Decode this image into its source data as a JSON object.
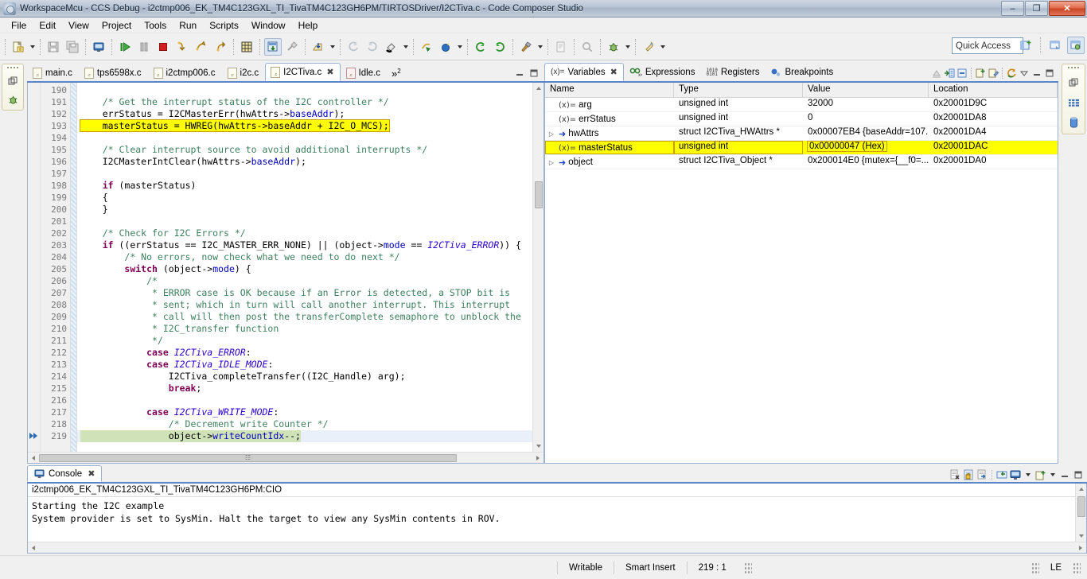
{
  "window": {
    "title": "WorkspaceMcu - CCS Debug - i2ctmp006_EK_TM4C123GXL_TI_TivaTM4C123GH6PM/TIRTOSDriver/I2CTiva.c - Code Composer Studio",
    "minimize_label": "–",
    "restore_label": "❐",
    "close_label": "✕"
  },
  "menu": {
    "items": [
      {
        "label": "File"
      },
      {
        "label": "Edit"
      },
      {
        "label": "View"
      },
      {
        "label": "Project"
      },
      {
        "label": "Tools"
      },
      {
        "label": "Run"
      },
      {
        "label": "Scripts"
      },
      {
        "label": "Window"
      },
      {
        "label": "Help"
      }
    ]
  },
  "toolbar": {
    "quick_access_placeholder": "Quick Access",
    "quick_access_value": "",
    "buttons": [
      {
        "name": "new-icon"
      },
      {
        "name": "save-icon"
      },
      {
        "name": "save-all-icon"
      },
      {
        "name": "open-console-icon"
      },
      {
        "name": "resume-icon"
      },
      {
        "name": "suspend-icon"
      },
      {
        "name": "terminate-icon"
      },
      {
        "name": "step-into-icon"
      },
      {
        "name": "step-over-icon"
      },
      {
        "name": "step-return-icon"
      },
      {
        "name": "grid-icon"
      },
      {
        "name": "load-program-icon"
      },
      {
        "name": "connect-target-icon"
      },
      {
        "name": "disconnect-target-icon"
      },
      {
        "name": "restart-icon"
      },
      {
        "name": "reset-icon"
      },
      {
        "name": "refresh-icon"
      },
      {
        "name": "build-icon"
      },
      {
        "name": "search-icon"
      },
      {
        "name": "debug-icon"
      },
      {
        "name": "run-icon"
      }
    ],
    "perspective": [
      {
        "name": "open-perspective-icon"
      },
      {
        "name": "perspective-ccs-edit-icon"
      },
      {
        "name": "perspective-ccs-debug-icon"
      }
    ]
  },
  "editor": {
    "tabs": [
      {
        "label": "main.c",
        "active": false,
        "dirty": false
      },
      {
        "label": "tps6598x.c",
        "active": false,
        "dirty": false
      },
      {
        "label": "i2ctmp006.c",
        "active": false,
        "dirty": false
      },
      {
        "label": "i2c.c",
        "active": false,
        "dirty": false
      },
      {
        "label": "I2CTiva.c",
        "active": true,
        "dirty": false
      },
      {
        "label": "Idle.c",
        "active": false,
        "dirty": false
      }
    ],
    "overflow_label": "»",
    "overflow_count": "2",
    "minimize_label": "─",
    "maximize_label": "❑",
    "first_line": 190,
    "lines": [
      {
        "n": 190,
        "tokens": []
      },
      {
        "n": 191,
        "tokens": [
          {
            "t": "    ",
            "c": ""
          },
          {
            "t": "/* Get the interrupt status of the I2C controller */",
            "c": "cmt"
          }
        ]
      },
      {
        "n": 192,
        "tokens": [
          {
            "t": "    errStatus = I2CMasterErr(hwAttrs->",
            "c": ""
          },
          {
            "t": "baseAddr",
            "c": "fld"
          },
          {
            "t": ");",
            "c": ""
          }
        ]
      },
      {
        "n": 193,
        "mark": true,
        "tokens": [
          {
            "t": "    masterStatus = HWREG(hwAttrs->baseAddr + I2C_O_MCS);",
            "c": ""
          }
        ]
      },
      {
        "n": 194,
        "tokens": []
      },
      {
        "n": 195,
        "tokens": [
          {
            "t": "    ",
            "c": ""
          },
          {
            "t": "/* Clear interrupt source to avoid additional interrupts */",
            "c": "cmt"
          }
        ]
      },
      {
        "n": 196,
        "tokens": [
          {
            "t": "    I2CMasterIntClear(hwAttrs->",
            "c": ""
          },
          {
            "t": "baseAddr",
            "c": "fld"
          },
          {
            "t": ");",
            "c": ""
          }
        ]
      },
      {
        "n": 197,
        "tokens": []
      },
      {
        "n": 198,
        "tokens": [
          {
            "t": "    ",
            "c": ""
          },
          {
            "t": "if",
            "c": "kw"
          },
          {
            "t": " (masterStatus)",
            "c": ""
          }
        ]
      },
      {
        "n": 199,
        "tokens": [
          {
            "t": "    {",
            "c": ""
          }
        ]
      },
      {
        "n": 200,
        "tokens": [
          {
            "t": "    }",
            "c": ""
          }
        ]
      },
      {
        "n": 201,
        "tokens": []
      },
      {
        "n": 202,
        "tokens": [
          {
            "t": "    ",
            "c": ""
          },
          {
            "t": "/* Check for I2C Errors */",
            "c": "cmt"
          }
        ]
      },
      {
        "n": 203,
        "tokens": [
          {
            "t": "    ",
            "c": ""
          },
          {
            "t": "if",
            "c": "kw"
          },
          {
            "t": " ((errStatus == I2C_MASTER_ERR_NONE) || (object->",
            "c": ""
          },
          {
            "t": "mode",
            "c": "fld"
          },
          {
            "t": " == ",
            "c": ""
          },
          {
            "t": "I2CTiva_ERROR",
            "c": "typ"
          },
          {
            "t": ")) {",
            "c": ""
          }
        ]
      },
      {
        "n": 204,
        "tokens": [
          {
            "t": "        ",
            "c": ""
          },
          {
            "t": "/* No errors, now check what we need to do next */",
            "c": "cmt"
          }
        ]
      },
      {
        "n": 205,
        "tokens": [
          {
            "t": "        ",
            "c": ""
          },
          {
            "t": "switch",
            "c": "kw"
          },
          {
            "t": " (object->",
            "c": ""
          },
          {
            "t": "mode",
            "c": "fld"
          },
          {
            "t": ") {",
            "c": ""
          }
        ]
      },
      {
        "n": 206,
        "tokens": [
          {
            "t": "            ",
            "c": ""
          },
          {
            "t": "/*",
            "c": "cmt"
          }
        ]
      },
      {
        "n": 207,
        "tokens": [
          {
            "t": "             ",
            "c": ""
          },
          {
            "t": "* ERROR case is OK because if an Error is detected, a STOP bit is",
            "c": "cmt"
          }
        ]
      },
      {
        "n": 208,
        "tokens": [
          {
            "t": "             ",
            "c": ""
          },
          {
            "t": "* sent; which in turn will call another interrupt. This interrupt",
            "c": "cmt"
          }
        ]
      },
      {
        "n": 209,
        "tokens": [
          {
            "t": "             ",
            "c": ""
          },
          {
            "t": "* call will then post the transferComplete semaphore to unblock the",
            "c": "cmt"
          }
        ]
      },
      {
        "n": 210,
        "tokens": [
          {
            "t": "             ",
            "c": ""
          },
          {
            "t": "* I2C_transfer function",
            "c": "cmt"
          }
        ]
      },
      {
        "n": 211,
        "tokens": [
          {
            "t": "             ",
            "c": ""
          },
          {
            "t": "*/",
            "c": "cmt"
          }
        ]
      },
      {
        "n": 212,
        "tokens": [
          {
            "t": "            ",
            "c": ""
          },
          {
            "t": "case",
            "c": "kw"
          },
          {
            "t": " ",
            "c": ""
          },
          {
            "t": "I2CTiva_ERROR",
            "c": "typ"
          },
          {
            "t": ":",
            "c": ""
          }
        ]
      },
      {
        "n": 213,
        "tokens": [
          {
            "t": "            ",
            "c": ""
          },
          {
            "t": "case",
            "c": "kw"
          },
          {
            "t": " ",
            "c": ""
          },
          {
            "t": "I2CTiva_IDLE_MODE",
            "c": "typ"
          },
          {
            "t": ":",
            "c": ""
          }
        ]
      },
      {
        "n": 214,
        "tokens": [
          {
            "t": "                I2CTiva_completeTransfer((I2C_Handle) arg);",
            "c": ""
          }
        ]
      },
      {
        "n": 215,
        "tokens": [
          {
            "t": "                ",
            "c": ""
          },
          {
            "t": "break",
            "c": "kw"
          },
          {
            "t": ";",
            "c": ""
          }
        ]
      },
      {
        "n": 216,
        "tokens": []
      },
      {
        "n": 217,
        "tokens": [
          {
            "t": "            ",
            "c": ""
          },
          {
            "t": "case",
            "c": "kw"
          },
          {
            "t": " ",
            "c": ""
          },
          {
            "t": "I2CTiva_WRITE_MODE",
            "c": "typ"
          },
          {
            "t": ":",
            "c": ""
          }
        ]
      },
      {
        "n": 218,
        "tokens": [
          {
            "t": "                ",
            "c": ""
          },
          {
            "t": "/* Decrement write Counter */",
            "c": "cmt"
          }
        ]
      },
      {
        "n": 219,
        "current": true,
        "exec": true,
        "tokens": [
          {
            "t": "                object->",
            "c": ""
          },
          {
            "t": "writeCountIdx",
            "c": "fld"
          },
          {
            "t": "--;",
            "c": ""
          }
        ]
      }
    ]
  },
  "variables": {
    "tabs": [
      {
        "label": "Variables",
        "icon": "variables-icon",
        "active": true,
        "closable": true
      },
      {
        "label": "Expressions",
        "icon": "expressions-icon",
        "active": false,
        "closable": false
      },
      {
        "label": "Registers",
        "icon": "registers-icon",
        "active": false,
        "closable": false
      },
      {
        "label": "Breakpoints",
        "icon": "breakpoints-icon",
        "active": false,
        "closable": false
      }
    ],
    "toolbar": [
      {
        "name": "collapse-watch-icon"
      },
      {
        "name": "show-type-names-icon"
      },
      {
        "name": "collapse-all-icon"
      },
      {
        "name": "new-watch-expression-icon"
      },
      {
        "name": "edit-watch-icon"
      },
      {
        "name": "refresh-variables-icon"
      },
      {
        "name": "view-menu-icon"
      },
      {
        "name": "minimize-icon"
      },
      {
        "name": "maximize-icon"
      }
    ],
    "columns": [
      "Name",
      "Type",
      "Value",
      "Location"
    ],
    "rows": [
      {
        "expandable": false,
        "icon": "value-icon",
        "name": "arg",
        "type": "unsigned int",
        "value": "32000",
        "location": "0x20001D9C",
        "highlight": false
      },
      {
        "expandable": false,
        "icon": "value-icon",
        "name": "errStatus",
        "type": "unsigned int",
        "value": "0",
        "location": "0x20001DA8",
        "highlight": false
      },
      {
        "expandable": true,
        "icon": "pointer-icon",
        "name": "hwAttrs",
        "type": "struct I2CTiva_HWAttrs *",
        "value": "0x00007EB4 {baseAddr=107...",
        "location": "0x20001DA4",
        "highlight": false
      },
      {
        "expandable": false,
        "icon": "value-icon",
        "name": "masterStatus",
        "type": "unsigned int",
        "value": "0x00000047 (Hex)",
        "location": "0x20001DAC",
        "highlight": true
      },
      {
        "expandable": true,
        "icon": "pointer-icon",
        "name": "object",
        "type": "struct I2CTiva_Object *",
        "value": "0x200014E0 {mutex={__f0=...",
        "location": "0x20001DA0",
        "highlight": false
      }
    ]
  },
  "console": {
    "tab_label": "Console",
    "tab_icon": "console-icon",
    "close_label": "✖",
    "title": "i2ctmp006_EK_TM4C123GXL_TI_TivaTM4C123GH6PM:CIO",
    "output": "Starting the I2C example\nSystem provider is set to SysMin. Halt the target to view any SysMin contents in ROV.",
    "toolbar": [
      {
        "name": "clear-console-icon"
      },
      {
        "name": "scroll-lock-icon"
      },
      {
        "name": "pin-console-icon"
      },
      {
        "name": "display-selected-console-icon"
      },
      {
        "name": "open-console-icon"
      },
      {
        "name": "new-console-view-icon"
      },
      {
        "name": "minimize-icon"
      },
      {
        "name": "maximize-icon"
      }
    ]
  },
  "statusbar": {
    "writable": "Writable",
    "insert_mode": "Smart Insert",
    "cursor_position": "219 : 1",
    "encoding": "LE"
  },
  "fastview": {
    "left": [
      {
        "name": "restore-icon"
      },
      {
        "name": "debug-bug-icon"
      }
    ],
    "right": [
      {
        "name": "restore-icon"
      },
      {
        "name": "memory-browser-icon"
      },
      {
        "name": "battery-icon"
      }
    ]
  },
  "colors": {
    "accent": "#5a86c8",
    "highlight_yellow": "#ffff00",
    "exec_line_green": "#cfe2b8",
    "cursor_line_blue": "#e9f0fa",
    "comment_green": "#3f7f5f",
    "keyword_purple": "#7f0055",
    "field_blue": "#0000c0",
    "type_indigo": "#2a00d0"
  }
}
